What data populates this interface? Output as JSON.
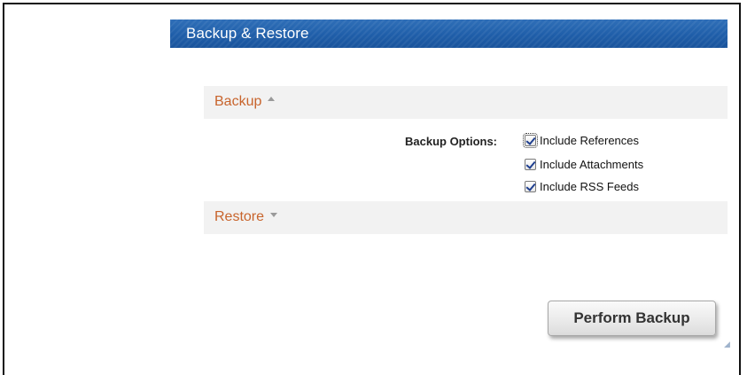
{
  "header": {
    "title": "Backup & Restore"
  },
  "backup_section": {
    "label": "Backup",
    "expanded": true,
    "options_label": "Backup Options:",
    "options": [
      {
        "label": "Include References",
        "checked": true
      },
      {
        "label": "Include Attachments",
        "checked": true
      },
      {
        "label": "Include RSS Feeds",
        "checked": true
      }
    ]
  },
  "restore_section": {
    "label": "Restore",
    "expanded": false
  },
  "actions": {
    "perform_backup_label": "Perform Backup"
  },
  "colors": {
    "header_bg": "#1f5ea9",
    "section_link": "#c8642c",
    "section_bg": "#f2f2f2"
  }
}
